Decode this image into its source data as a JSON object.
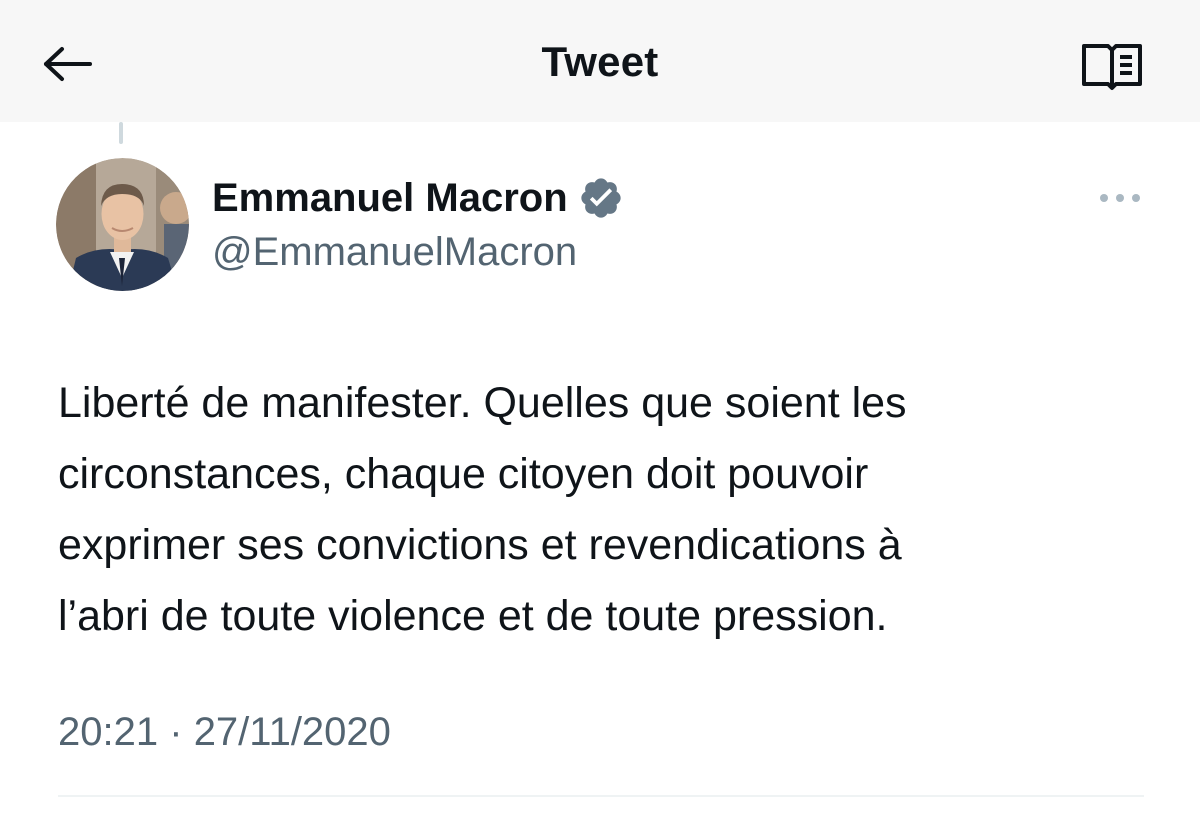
{
  "header": {
    "title": "Tweet",
    "back_icon": "arrow-left-icon",
    "reader_icon": "book-open-icon"
  },
  "tweet": {
    "author": {
      "display_name": "Emmanuel Macron",
      "handle": "@EmmanuelMacron",
      "verified": true,
      "verified_color": "#657786"
    },
    "text_lines": [
      "Liberté de manifester. Quelles que soient les",
      "circonstances, chaque citoyen doit pouvoir",
      "exprimer ses convictions et revendications à",
      "l’abri de toute violence et de toute pression."
    ],
    "time": "20:21",
    "separator": "·",
    "date": "27/11/2020"
  },
  "colors": {
    "primary_text": "#0f1419",
    "secondary_text": "#536471",
    "header_bg": "#f7f7f7",
    "divider": "#eff3f4"
  }
}
